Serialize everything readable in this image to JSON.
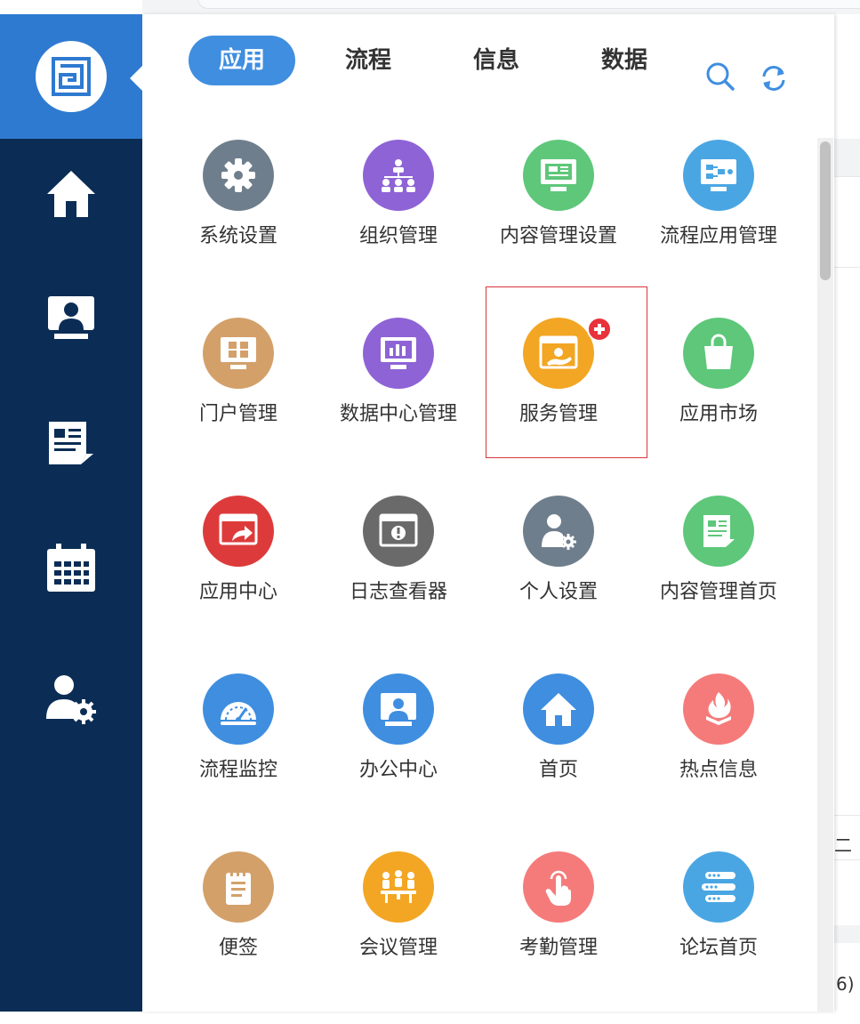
{
  "tabs": [
    {
      "label": "应用",
      "active": true
    },
    {
      "label": "流程",
      "active": false
    },
    {
      "label": "信息",
      "active": false
    },
    {
      "label": "数据",
      "active": false
    }
  ],
  "toolbar_icons": [
    "search-icon",
    "refresh-icon"
  ],
  "sidebar": {
    "logo_icon": "logo-icon",
    "items": [
      "home-icon",
      "monitor-user-icon",
      "news-icon",
      "calendar-icon",
      "user-settings-icon"
    ]
  },
  "apps": [
    {
      "label": "系统设置",
      "color": "#6f7e8c",
      "icon": "gear-icon"
    },
    {
      "label": "组织管理",
      "color": "#8e63d6",
      "icon": "org-chart-icon"
    },
    {
      "label": "内容管理设置",
      "color": "#5ec77a",
      "icon": "content-settings-icon"
    },
    {
      "label": "流程应用管理",
      "color": "#4aa6e3",
      "icon": "flow-app-icon"
    },
    {
      "label": "门户管理",
      "color": "#d3a06a",
      "icon": "portal-icon"
    },
    {
      "label": "数据中心管理",
      "color": "#8e63d6",
      "icon": "data-center-icon"
    },
    {
      "label": "服务管理",
      "color": "#f2a624",
      "icon": "service-icon"
    },
    {
      "label": "应用市场",
      "color": "#5ec77a",
      "icon": "shopping-bag-icon"
    },
    {
      "label": "应用中心",
      "color": "#dd3b3b",
      "icon": "share-window-icon"
    },
    {
      "label": "日志查看器",
      "color": "#6a6a6a",
      "icon": "log-viewer-icon"
    },
    {
      "label": "个人设置",
      "color": "#6f7e8c",
      "icon": "personal-settings-icon"
    },
    {
      "label": "内容管理首页",
      "color": "#5ec77a",
      "icon": "news-icon"
    },
    {
      "label": "流程监控",
      "color": "#3f8ee0",
      "icon": "gauge-icon"
    },
    {
      "label": "办公中心",
      "color": "#3f8ee0",
      "icon": "monitor-user-icon"
    },
    {
      "label": "首页",
      "color": "#3f8ee0",
      "icon": "home-icon"
    },
    {
      "label": "热点信息",
      "color": "#f57b7b",
      "icon": "flame-icon"
    },
    {
      "label": "便签",
      "color": "#d3a06a",
      "icon": "note-icon"
    },
    {
      "label": "会议管理",
      "color": "#f2a624",
      "icon": "meeting-icon"
    },
    {
      "label": "考勤管理",
      "color": "#f57b7b",
      "icon": "finger-tap-icon"
    },
    {
      "label": "论坛首页",
      "color": "#4aa6e3",
      "icon": "forum-icon"
    }
  ],
  "selected_app": "服务管理",
  "selected_badge_icon": "plus-badge-icon",
  "background_fragments": [
    "二",
    "6)"
  ]
}
